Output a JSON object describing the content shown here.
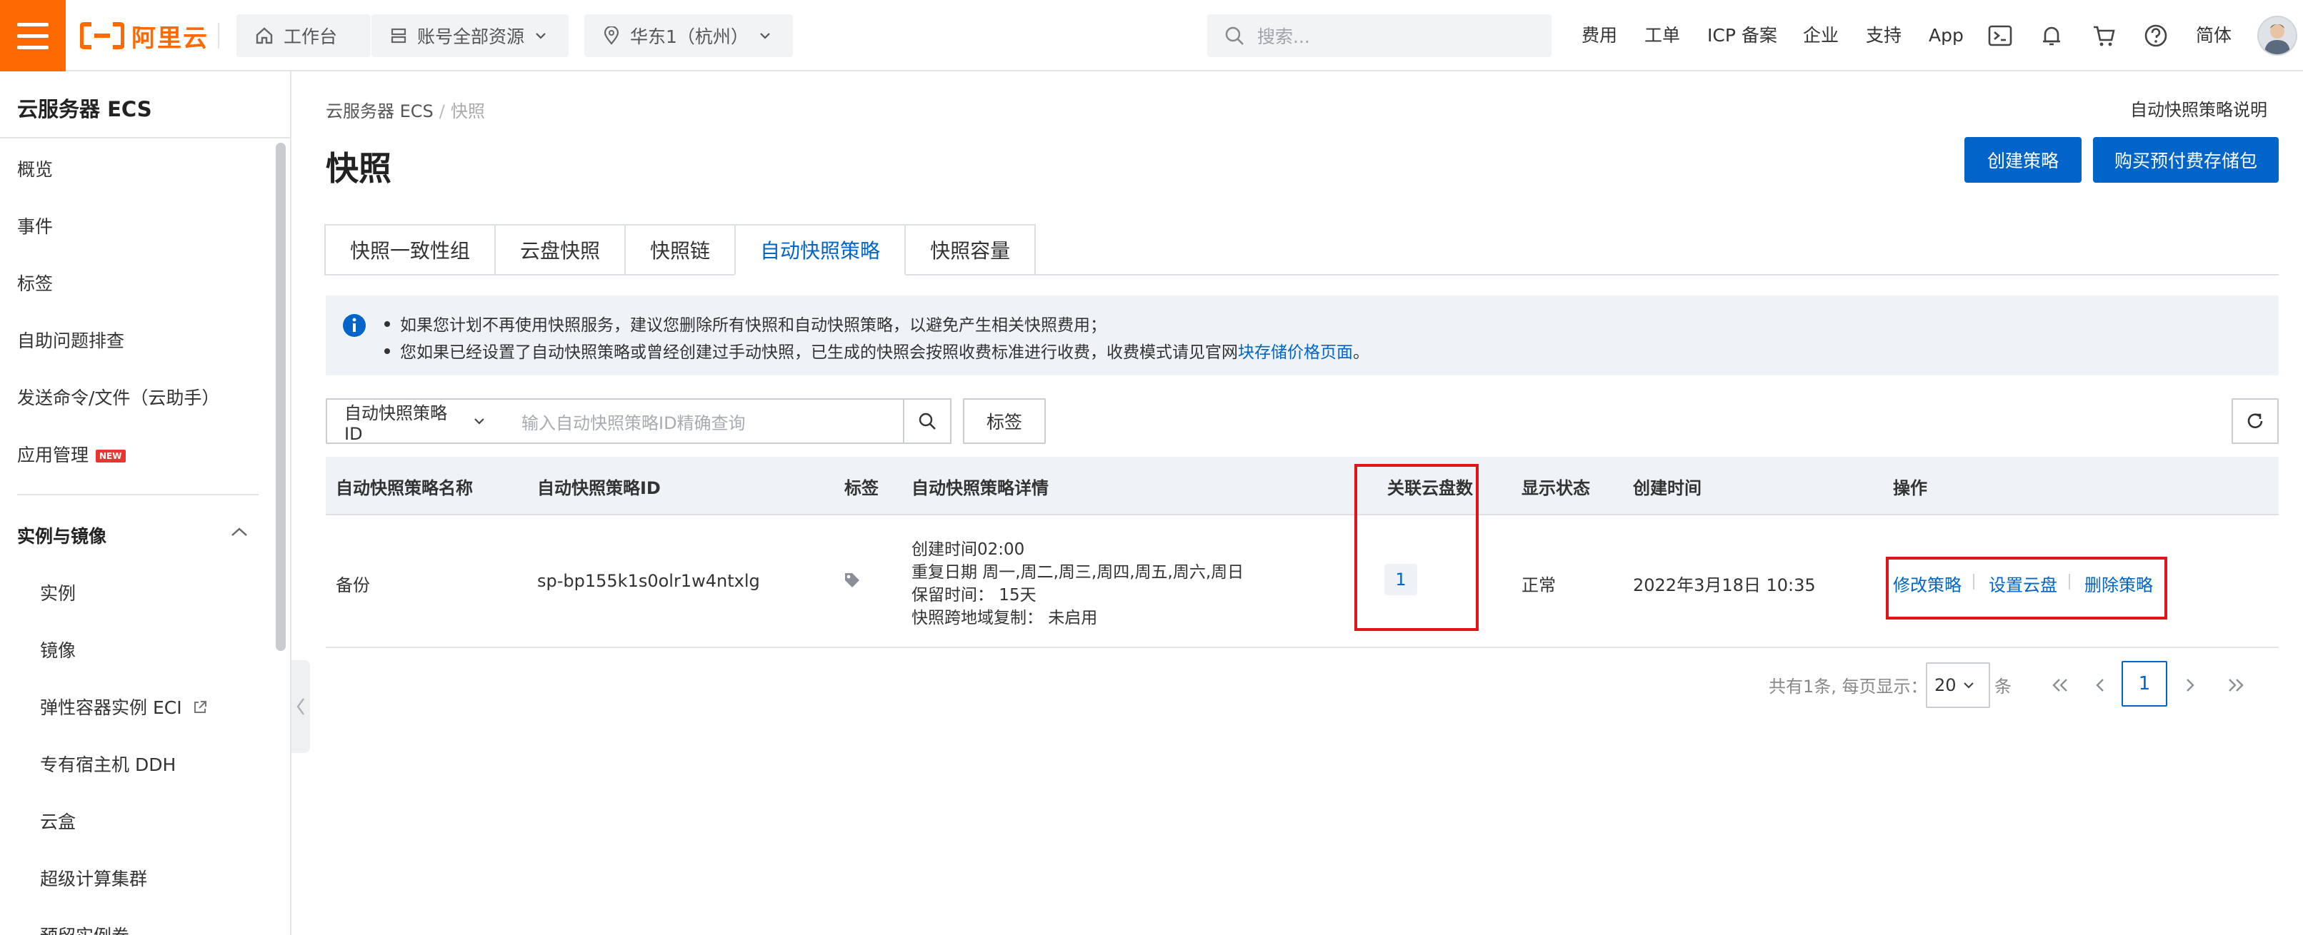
{
  "topbar": {
    "logo_text": "阿里云",
    "workbench": "工作台",
    "resources": "账号全部资源",
    "region": "华东1（杭州）",
    "search_placeholder": "搜索...",
    "links": [
      "费用",
      "工单",
      "ICP 备案",
      "企业",
      "支持",
      "App"
    ],
    "language": "简体"
  },
  "sidebar": {
    "title": "云服务器 ECS",
    "items": [
      "概览",
      "事件",
      "标签",
      "自助问题排查",
      "发送命令/文件（云助手）",
      "应用管理"
    ],
    "new_badge": "NEW",
    "group": "实例与镜像",
    "sub_items": [
      "实例",
      "镜像",
      "弹性容器实例 ECI",
      "专有宿主机 DDH",
      "云盒",
      "超级计算集群",
      "预留实例券"
    ]
  },
  "main": {
    "breadcrumb": [
      "云服务器 ECS",
      "快照"
    ],
    "title": "快照",
    "help_link": "自动快照策略说明",
    "create_button": "创建策略",
    "buy_button": "购买预付费存储包",
    "tabs": [
      "快照一致性组",
      "云盘快照",
      "快照链",
      "自动快照策略",
      "快照容量"
    ],
    "active_tab": "自动快照策略",
    "notice": {
      "line1": "如果您计划不再使用快照服务，建议您删除所有快照和自动快照策略，以避免产生相关快照费用；",
      "line2_prefix": "您如果已经设置了自动快照策略或曾经创建过手动快照，已生成的快照会按照收费标准进行收费，收费模式请见官网",
      "line2_link": "块存储价格页面",
      "line2_suffix": "。"
    },
    "filter": {
      "select": "自动快照策略ID",
      "placeholder": "输入自动快照策略ID精确查询",
      "tag_button": "标签"
    },
    "table": {
      "headers": [
        "自动快照策略名称",
        "自动快照策略ID",
        "标签",
        "自动快照策略详情",
        "关联云盘数",
        "显示状态",
        "创建时间",
        "操作"
      ],
      "row": {
        "name": "备份",
        "id": "sp-bp155k1s0olr1w4ntxlg",
        "details": [
          "创建时间02:00",
          "重复日期 周一,周二,周三,周四,周五,周六,周日",
          "保留时间：  15天",
          "快照跨地域复制：  未启用"
        ],
        "disk_count": "1",
        "status": "正常",
        "created": "2022年3月18日 10:35",
        "actions": [
          "修改策略",
          "设置云盘",
          "删除策略"
        ]
      }
    },
    "pagination": {
      "total": "共有1条, 每页显示：",
      "page_size": "20",
      "unit": "条",
      "current_page": "1"
    }
  },
  "colors": {
    "brand": "#ff6a00",
    "primary": "#0064c8",
    "highlight": "#e0151a"
  }
}
